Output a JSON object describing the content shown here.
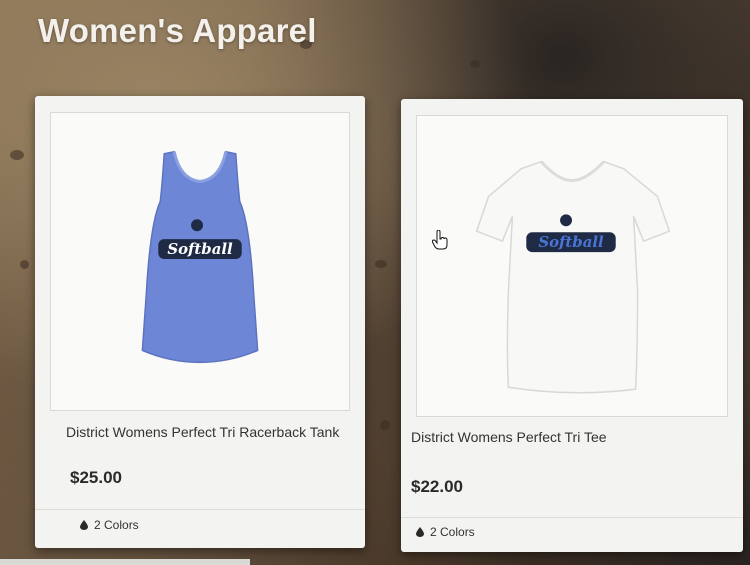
{
  "page": {
    "title": "Women's Apparel"
  },
  "products": [
    {
      "name": "District Womens Perfect Tri Racerback Tank",
      "price": "$25.00",
      "colors": "2 Colors",
      "shirt_color": "#6d86d6",
      "logo_text": "Softball"
    },
    {
      "name": "District Womens Perfect Tri Tee",
      "price": "$22.00",
      "colors": "2 Colors",
      "shirt_color": "#f8f8f6",
      "logo_text": "Softball"
    }
  ]
}
